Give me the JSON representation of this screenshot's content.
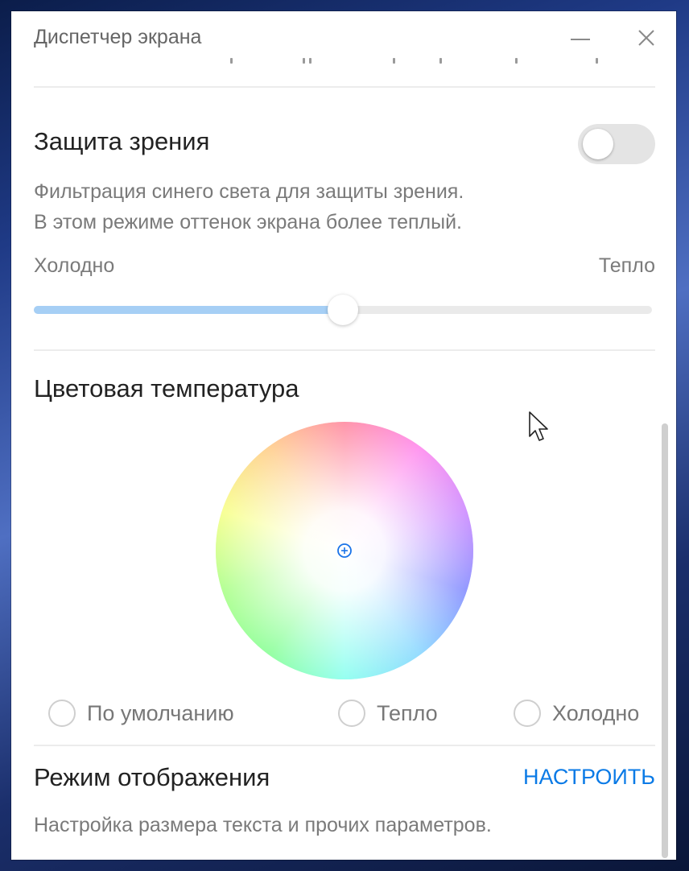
{
  "window": {
    "title": "Диспетчер экрана"
  },
  "eye_protection": {
    "title": "Защита зрения",
    "toggle_on": false,
    "description_line1": "Фильтрация синего света для защиты зрения.",
    "description_line2": "В этом режиме оттенок экрана более теплый.",
    "slider_left_label": "Холодно",
    "slider_right_label": "Тепло",
    "slider_value_percent": 50
  },
  "color_temperature": {
    "title": "Цветовая температура",
    "options": [
      {
        "label": "По умолчанию",
        "selected": false
      },
      {
        "label": "Тепло",
        "selected": false
      },
      {
        "label": "Холодно",
        "selected": false
      }
    ]
  },
  "display_mode": {
    "title": "Режим отображения",
    "action_label": "НАСТРОИТЬ",
    "description": "Настройка размера текста и прочих параметров."
  },
  "colors": {
    "accent": "#0a7ae6",
    "slider_fill": "#a6cff5",
    "toggle_off_track": "#e4e4e4"
  }
}
